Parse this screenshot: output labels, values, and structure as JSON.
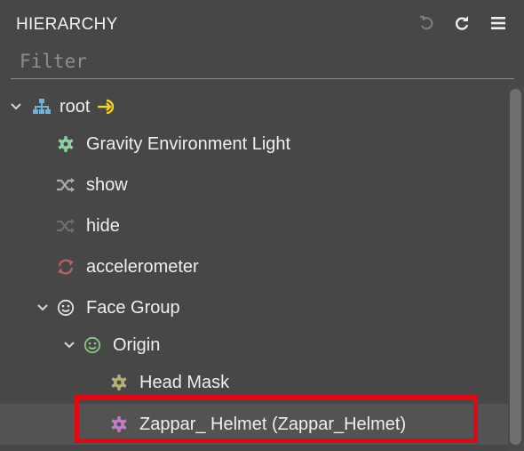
{
  "panel": {
    "title": "HIERARCHY",
    "filter_placeholder": "Filter",
    "filter_value": ""
  },
  "header_icons": [
    "undo-icon",
    "refresh-icon",
    "menu-icon"
  ],
  "tree": [
    {
      "label": "root",
      "icon": "hierarchy-icon",
      "expanded": true,
      "badge": "entry-arrow-icon"
    },
    {
      "label": "Gravity Environment Light",
      "icon": "gear-icon"
    },
    {
      "label": "show",
      "icon": "shuffle-icon"
    },
    {
      "label": "hide",
      "icon": "shuffle-icon"
    },
    {
      "label": "accelerometer",
      "icon": "sync-icon"
    },
    {
      "label": "Face Group",
      "icon": "smiley-icon",
      "expanded": true
    },
    {
      "label": "Origin",
      "icon": "smiley-icon",
      "expanded": true
    },
    {
      "label": "Head Mask",
      "icon": "gear-icon"
    },
    {
      "label": "Zappar_ Helmet (Zappar_Helmet)",
      "icon": "gear-icon",
      "selected": true
    }
  ],
  "colors": {
    "panel_bg": "#474747",
    "root_icon": "#6cb4d8",
    "root_badge": "#f2d21b",
    "light_gear": "#8fd19e",
    "show_shuffle": "#a9a9a9",
    "hide_shuffle": "#6e6e6e",
    "accelerometer_sync": "#b86060",
    "face_group_smiley": "#e0e0e0",
    "origin_smiley": "#8cc884",
    "head_mask_gear": "#b5ae78",
    "helmet_gear": "#c87ac8",
    "highlight": "#e30613"
  }
}
